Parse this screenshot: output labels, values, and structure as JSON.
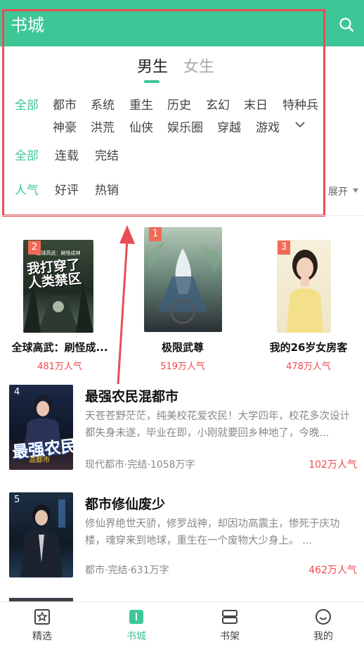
{
  "header": {
    "title": "书城",
    "search_icon": "search-icon"
  },
  "gender_tabs": {
    "male": "男生",
    "female": "女生",
    "active": "male"
  },
  "categories": [
    "全部",
    "都市",
    "系统",
    "重生",
    "历史",
    "玄幻",
    "末日",
    "特种兵",
    "神豪",
    "洪荒",
    "仙侠",
    "娱乐圈",
    "穿越",
    "游戏"
  ],
  "status_filters": [
    "全部",
    "连载",
    "完结"
  ],
  "sort_filters": [
    "人气",
    "好评",
    "热销"
  ],
  "expand_label": "展开",
  "top_books": [
    {
      "rank": "2",
      "title": "全球高武：刷怪成...",
      "popularity": "481万人气"
    },
    {
      "rank": "1",
      "title": "极限武尊",
      "popularity": "519万人气"
    },
    {
      "rank": "3",
      "title": "我的26岁女房客",
      "popularity": "478万人气"
    }
  ],
  "cover_texts": {
    "book2_main": "我打穿了人类禁区",
    "book2_top": "全球高武：刷怪成神",
    "book4_main": "最强农民",
    "book4_sub": "混都市"
  },
  "list_books": [
    {
      "rank": "4",
      "title": "最强农民混都市",
      "desc": "天苍苍野茫茫，纯美校花爱农民！大学四年，校花多次设计都失身未遂，毕业在即，小刚就要回乡种地了，今晚...",
      "meta": "现代都市·完结·1058万字",
      "popularity": "102万人气"
    },
    {
      "rank": "5",
      "title": "都市修仙废少",
      "desc": "修仙界绝世天骄，修罗战神，却因功高震主，惨死于庆功楼，魂穿来到地球，重生在一个废物大少身上。 ...",
      "meta": "都市·完结·631万字",
      "popularity": "462万人气"
    }
  ],
  "bottom_nav": [
    {
      "label": "精选",
      "icon": "featured-icon"
    },
    {
      "label": "书城",
      "icon": "bookstore-icon",
      "active": true
    },
    {
      "label": "书架",
      "icon": "bookshelf-icon"
    },
    {
      "label": "我的",
      "icon": "profile-icon"
    }
  ],
  "colors": {
    "accent": "#3ec796",
    "highlight_border": "#e94d55",
    "popularity": "#f2474f"
  }
}
